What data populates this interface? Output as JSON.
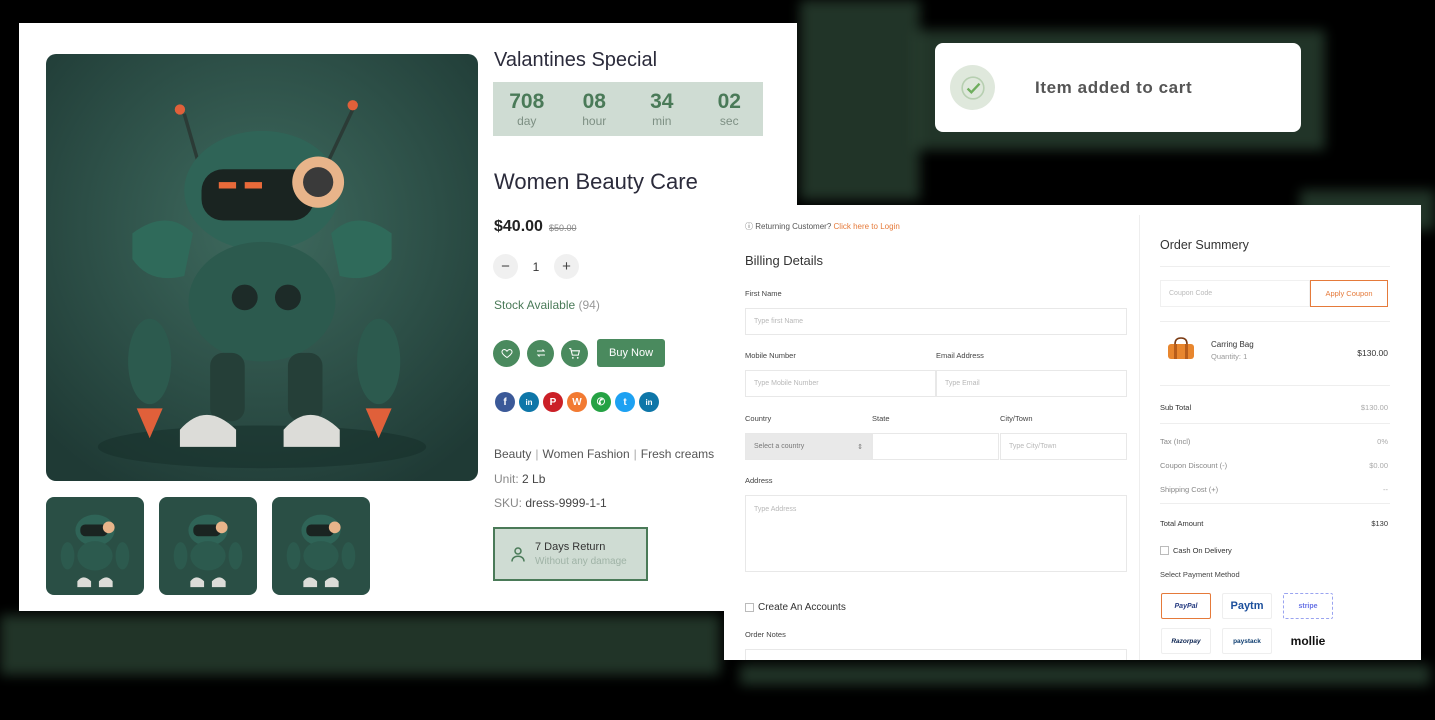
{
  "product": {
    "offer_title": "Valantines Special",
    "countdown": [
      {
        "value": "708",
        "label": "day"
      },
      {
        "value": "08",
        "label": "hour"
      },
      {
        "value": "34",
        "label": "min"
      },
      {
        "value": "02",
        "label": "sec"
      }
    ],
    "name": "Women Beauty Care",
    "price": "$40.00",
    "old_price": "$50.00",
    "quantity": "1",
    "qty_minus": "−",
    "qty_plus": "+",
    "stock_label": "Stock Available",
    "stock_count": "(94)",
    "buy_now": "Buy Now",
    "action_icons": [
      "heart-icon",
      "compare-icon",
      "cart-icon"
    ],
    "socials": [
      {
        "name": "facebook-icon",
        "glyph": "f",
        "color": "#3b5998"
      },
      {
        "name": "linkedin-icon",
        "glyph": "in",
        "color": "#0e76a8"
      },
      {
        "name": "pinterest-icon",
        "glyph": "P",
        "color": "#cb2027"
      },
      {
        "name": "weibo-icon",
        "glyph": "W",
        "color": "#f27a32"
      },
      {
        "name": "whatsapp-icon",
        "glyph": "✆",
        "color": "#25a244"
      },
      {
        "name": "twitter-icon",
        "glyph": "t",
        "color": "#1da1f2"
      },
      {
        "name": "linkedin-icon",
        "glyph": "in",
        "color": "#0e76a8"
      }
    ],
    "tags": [
      "Beauty",
      "Women Fashion",
      "Fresh creams"
    ],
    "unit_label": "Unit:",
    "unit_value": "2 Lb",
    "sku_label": "SKU:",
    "sku_value": "dress-9999-1-1",
    "return_title": "7 Days Return",
    "return_sub": "Without any damage",
    "accent_color": "#4a8a5e"
  },
  "toast": {
    "message": "Item added to cart"
  },
  "checkout": {
    "returning_text": "Returning Customer?",
    "returning_link": "Click here to Login",
    "billing_title": "Billing Details",
    "first_name_label": "First Name",
    "first_name_placeholder": "Type first Name",
    "mobile_label": "Mobile Number",
    "mobile_placeholder": "Type Mobile Number",
    "email_label": "Email Address",
    "email_placeholder": "Type Email",
    "country_label": "Country",
    "country_value": "Select a country",
    "state_label": "State",
    "city_label": "City/Town",
    "city_placeholder": "Type City/Town",
    "address_label": "Address",
    "address_placeholder": "Type Address",
    "create_account": "Create An Accounts",
    "order_notes_label": "Order Notes",
    "summary": {
      "title": "Order Summery",
      "coupon_placeholder": "Coupon Code",
      "coupon_button": "Apply Coupon",
      "item_name": "Carring Bag",
      "item_qty": "Quantity: 1",
      "item_price": "$130.00",
      "sub_total_label": "Sub Total",
      "sub_total": "$130.00",
      "tax_label": "Tax (Incl)",
      "tax": "0%",
      "discount_label": "Coupon Discount (-)",
      "discount": "$0.00",
      "shipping_label": "Shipping Cost (+)",
      "shipping": "--",
      "total_label": "Total Amount",
      "total": "$130",
      "cod_label": "Cash On Delivery",
      "pay_method_label": "Select Payment Method",
      "payment_methods": [
        {
          "label": "PayPal",
          "color": "#253b80"
        },
        {
          "label": "Paytm",
          "color": "#1c4f9c"
        },
        {
          "label": "stripe",
          "color": "#6772e5"
        },
        {
          "label": "Razorpay",
          "color": "#0c2451"
        },
        {
          "label": "paystack",
          "color": "#0b3b6e"
        },
        {
          "label": "mollie",
          "color": "#111111"
        }
      ],
      "orange_accent": "#e57a3a"
    }
  }
}
